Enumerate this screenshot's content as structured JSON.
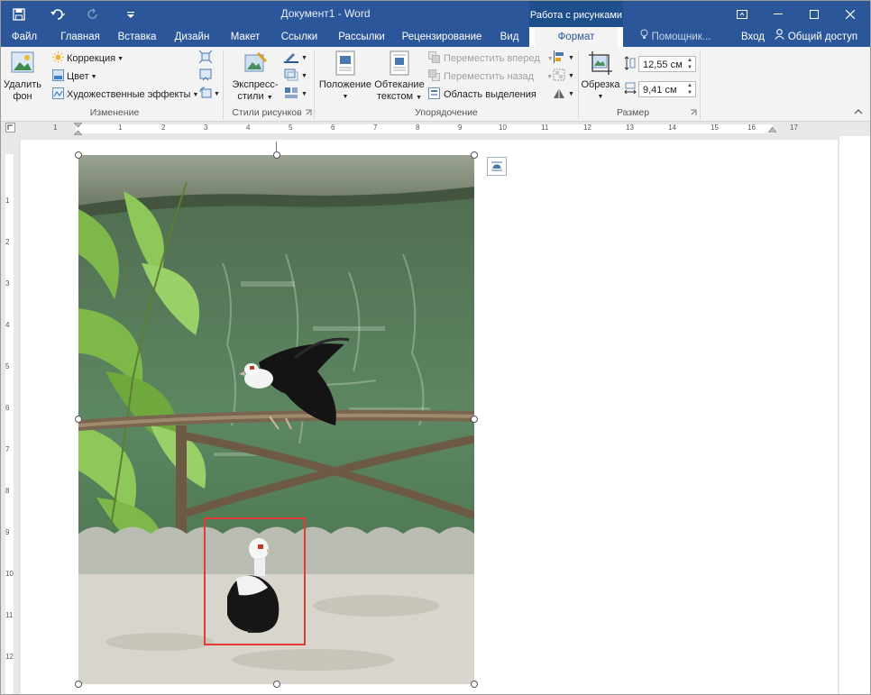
{
  "titlebar": {
    "doc_title": "Документ1 - Word",
    "context_group": "Работа с рисунками"
  },
  "tabs": [
    {
      "label": "Файл"
    },
    {
      "label": "Главная"
    },
    {
      "label": "Вставка"
    },
    {
      "label": "Дизайн"
    },
    {
      "label": "Макет"
    },
    {
      "label": "Ссылки"
    },
    {
      "label": "Рассылки"
    },
    {
      "label": "Рецензирование"
    },
    {
      "label": "Вид"
    },
    {
      "label": "Формат"
    }
  ],
  "tab_right": {
    "help": "Помощник...",
    "signin": "Вход",
    "share": "Общий доступ"
  },
  "ribbon": {
    "remove_bg": [
      "Удалить",
      "фон"
    ],
    "correction": "Коррекция",
    "color": "Цвет",
    "artistic": "Художественные эффекты",
    "group_change": "Изменение",
    "express": [
      "Экспресс-",
      "стили"
    ],
    "group_styles": "Стили рисунков",
    "position": "Положение",
    "wrap": [
      "Обтекание",
      "текстом"
    ],
    "bring_forward": "Переместить вперед",
    "send_backward": "Переместить назад",
    "selection_pane": "Область выделения",
    "group_arrange": "Упорядочение",
    "crop": "Обрезка",
    "height": "12,55 см",
    "width": "9,41 см",
    "group_size": "Размер"
  },
  "ruler": {
    "h_numbers": [
      "1",
      "1",
      "2",
      "3",
      "4",
      "5",
      "6",
      "7",
      "8",
      "9",
      "10",
      "11",
      "12",
      "13",
      "14",
      "15",
      "16",
      "17"
    ],
    "v_numbers": [
      "1",
      "2",
      "3",
      "4",
      "5",
      "6",
      "7",
      "8",
      "9",
      "10",
      "11",
      "12"
    ]
  },
  "colors": {
    "brand_blue": "#2b579a",
    "ribbon_bg": "#f3f3f3",
    "highlight_red": "#e53935"
  }
}
